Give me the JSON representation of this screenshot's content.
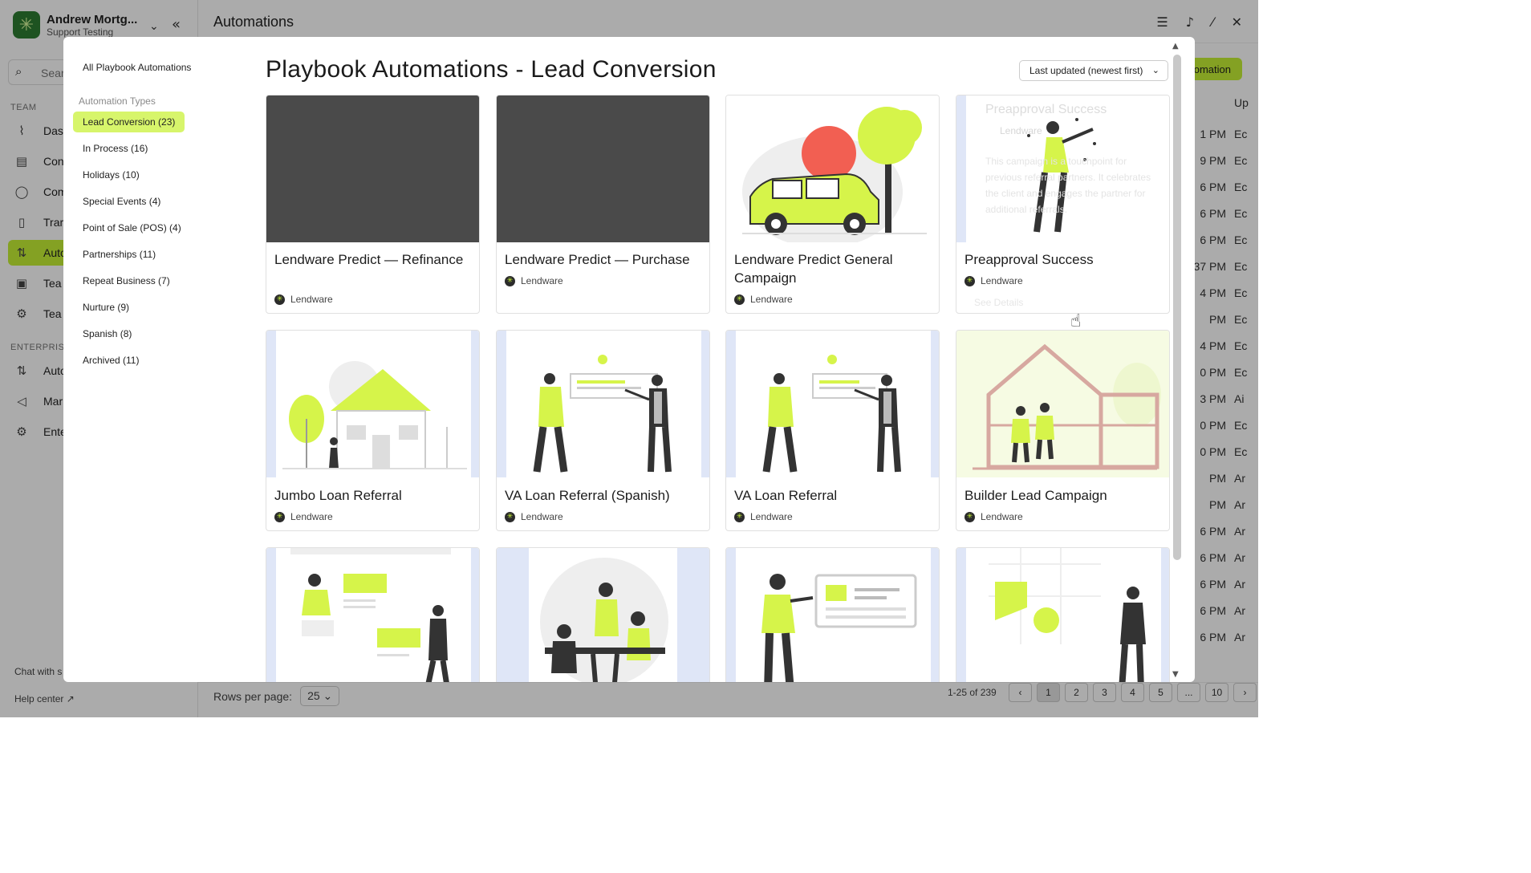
{
  "app": {
    "account_name": "Andrew Mortg...",
    "account_sub": "Support Testing",
    "search_placeholder": "Sear",
    "team_section": "TEAM",
    "enterprise_section": "ENTERPRISE",
    "team_nav": [
      "Das",
      "Con",
      "Com",
      "Trar",
      "Auto",
      "Tea",
      "Tea"
    ],
    "enterprise_nav": [
      "Auto",
      "Mar",
      "Ente"
    ],
    "chat": "Chat with s",
    "help": "Help center",
    "page_title": "Automations",
    "add_button": "utomation",
    "col_header": "Up",
    "bg_rows": [
      {
        "t": "1 PM",
        "u": "Ec"
      },
      {
        "t": "9 PM",
        "u": "Ec"
      },
      {
        "t": "6 PM",
        "u": "Ec"
      },
      {
        "t": "6 PM",
        "u": "Ec"
      },
      {
        "t": "6 PM",
        "u": "Ec"
      },
      {
        "t": "37 PM",
        "u": "Ec"
      },
      {
        "t": "4 PM",
        "u": "Ec"
      },
      {
        "t": "PM",
        "u": "Ec"
      },
      {
        "t": "4 PM",
        "u": "Ec"
      },
      {
        "t": "0 PM",
        "u": "Ec"
      },
      {
        "t": "3 PM",
        "u": "Ai"
      },
      {
        "t": "0 PM",
        "u": "Ec"
      },
      {
        "t": "0 PM",
        "u": "Ec"
      },
      {
        "t": "PM",
        "u": "Ar"
      },
      {
        "t": "PM",
        "u": "Ar"
      },
      {
        "t": "6 PM",
        "u": "Ar"
      },
      {
        "t": "6 PM",
        "u": "Ar"
      },
      {
        "t": "6 PM",
        "u": "Ar"
      },
      {
        "t": "6 PM",
        "u": "Ar"
      },
      {
        "t": "6 PM",
        "u": "Ar"
      }
    ],
    "rows_per_page_label": "Rows per page:",
    "rows_per_page": "25",
    "range": "1-25 of 239",
    "pages": [
      "1",
      "2",
      "3",
      "4",
      "5",
      "...",
      "10"
    ]
  },
  "modal": {
    "all_link": "All Playbook Automations",
    "types_header": "Automation Types",
    "categories": [
      "Lead Conversion (23)",
      "In Process (16)",
      "Holidays (10)",
      "Special Events (4)",
      "Point of Sale (POS) (4)",
      "Partnerships (11)",
      "Repeat Business (7)",
      "Nurture (9)",
      "Spanish (8)",
      "Archived (11)"
    ],
    "title": "Playbook Automations - Lead Conversion",
    "sort": "Last updated (newest first)",
    "cards": [
      {
        "title": "Lendware Predict — Refinance",
        "author": "Lendware"
      },
      {
        "title": "Lendware Predict — Purchase",
        "author": "Lendware"
      },
      {
        "title": "Lendware Predict General Campaign",
        "author": "Lendware"
      },
      {
        "title": "Preapproval Success",
        "author": "Lendware"
      },
      {
        "title": "Jumbo Loan Referral",
        "author": "Lendware"
      },
      {
        "title": "VA Loan Referral (Spanish)",
        "author": "Lendware"
      },
      {
        "title": "VA Loan Referral",
        "author": "Lendware"
      },
      {
        "title": "Builder Lead Campaign",
        "author": "Lendware"
      }
    ],
    "hover": {
      "title": "Preapproval Success",
      "author": "Lendware",
      "desc": "This campaign is a touchpoint for previous referral partners. It celebrates the client and engages the partner for additional referrals.",
      "see_details": "See Details"
    }
  },
  "colors": {
    "accent": "#c5f135",
    "accent_soft": "#d7f56b",
    "dark_thumb": "#4a4a4a"
  }
}
